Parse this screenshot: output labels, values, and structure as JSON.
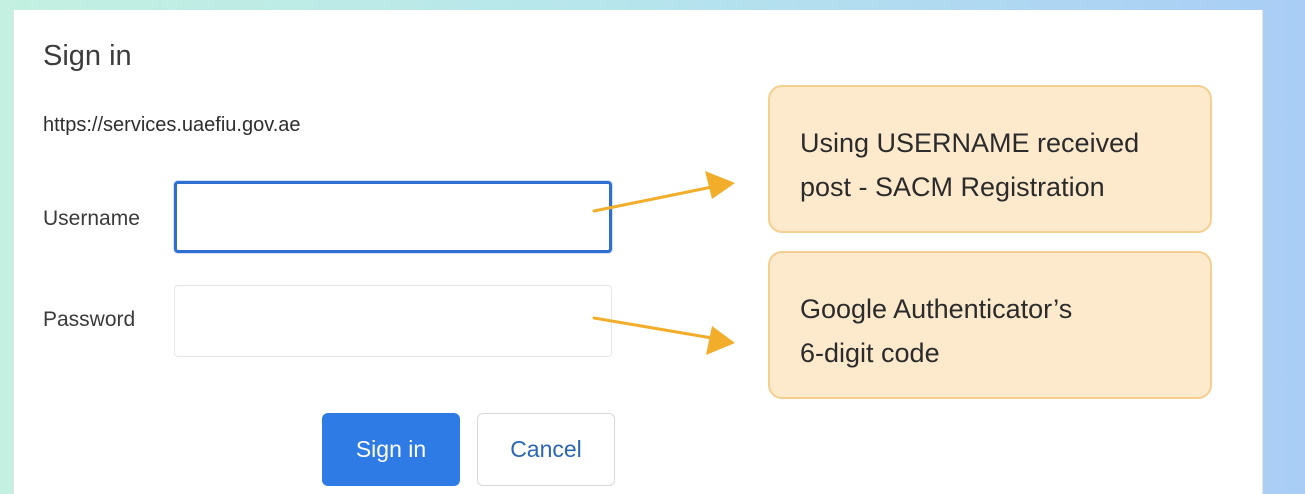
{
  "dialog": {
    "title": "Sign in",
    "url": "https://services.uaefiu.gov.ae"
  },
  "form": {
    "username_label": "Username",
    "username_value": "",
    "password_label": "Password",
    "password_value": ""
  },
  "buttons": {
    "sign_in_label": "Sign in",
    "cancel_label": "Cancel"
  },
  "callouts": {
    "username_note_line1": "Using USERNAME received",
    "username_note_line2": "post - SACM Registration",
    "password_note_line1": "Google Authenticator’s",
    "password_note_line2": "6-digit code"
  },
  "colors": {
    "primary_button": "#2f7be6",
    "focus_border": "#2f6fd1",
    "callout_fill": "#fde9cc",
    "callout_border": "#f5cf8f",
    "arrow": "#f2ad2b"
  }
}
